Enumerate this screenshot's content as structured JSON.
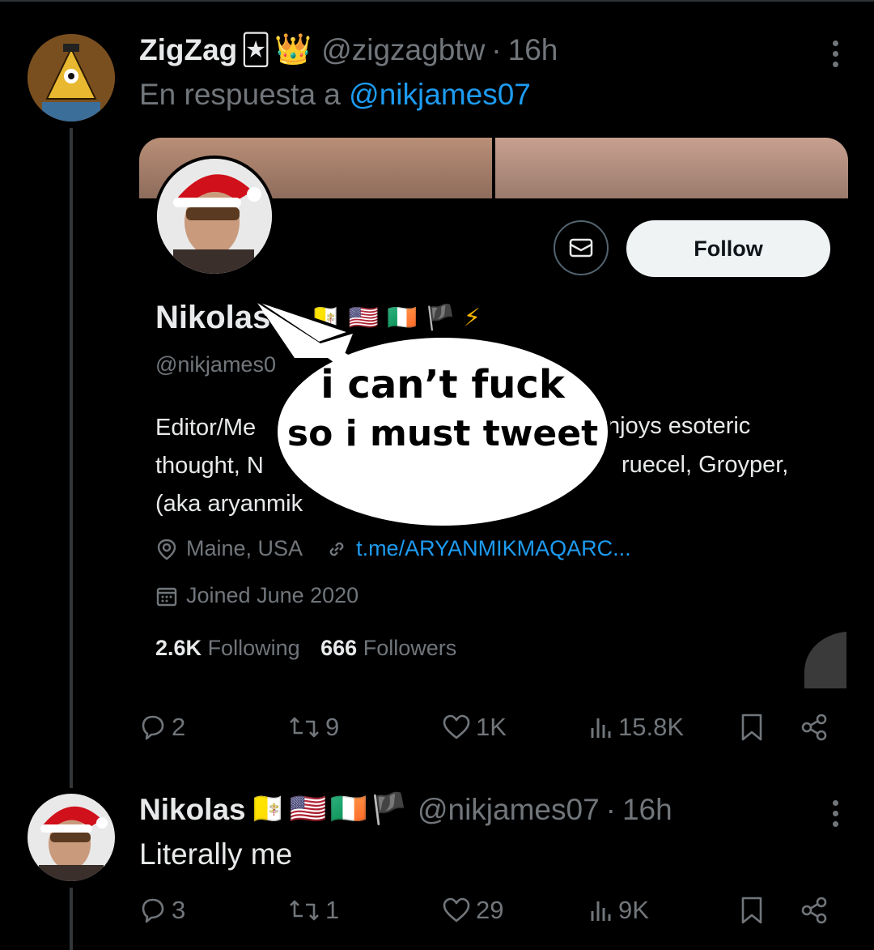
{
  "tweet1": {
    "name": "ZigZag",
    "name_emojis": [
      "🃏",
      "👑"
    ],
    "handle": "@zigzagbtw",
    "separator": "·",
    "time": "16h",
    "reply_prefix": "En respuesta a",
    "reply_mention": "@nikjames07",
    "stats": {
      "replies": "2",
      "reposts": "9",
      "likes": "1K",
      "views": "15.8K"
    }
  },
  "profile_card": {
    "follow_label": "Follow",
    "name": "Nikola",
    "name_suffix": "s",
    "name_emojis": [
      "⊕",
      "🇻🇦",
      "🇺🇸",
      "🇮🇪",
      "🏴",
      "⚡"
    ],
    "handle": "@nikjames0",
    "bio_line1_left": "Editor/Me",
    "bio_line1_right": "njoys esoteric",
    "bio_line2_left": "thought, N",
    "bio_line2_right": "ruecel, Groyper,",
    "bio_line3_left": "(aka aryanmik",
    "location": "Maine, USA",
    "link": "t.me/ARYANMIKMAQARC...",
    "joined": "Joined June 2020",
    "following_count": "2.6K",
    "following_label": "Following",
    "followers_count": "666",
    "followers_label": "Followers"
  },
  "speech_bubble": {
    "line1": "i can’t fuck",
    "line2": "so i must tweet"
  },
  "tweet2": {
    "name": "Nikolas",
    "name_emojis": [
      "🇻🇦",
      "🇺🇸",
      "🇮🇪",
      "🏴"
    ],
    "handle": "@nikjames07",
    "separator": "·",
    "time": "16h",
    "text": "Literally me",
    "stats": {
      "replies": "3",
      "reposts": "1",
      "likes": "29",
      "views": "9K"
    }
  },
  "colors": {
    "background": "#000000",
    "text": "#e7e9ea",
    "muted": "#71767b",
    "link": "#1d9bf0",
    "follow_bg": "#eff3f4"
  },
  "icons": [
    "reply-icon",
    "repost-icon",
    "like-icon",
    "views-icon",
    "bookmark-icon",
    "share-icon",
    "more-icon",
    "message-icon",
    "location-icon",
    "link-icon",
    "calendar-icon"
  ]
}
